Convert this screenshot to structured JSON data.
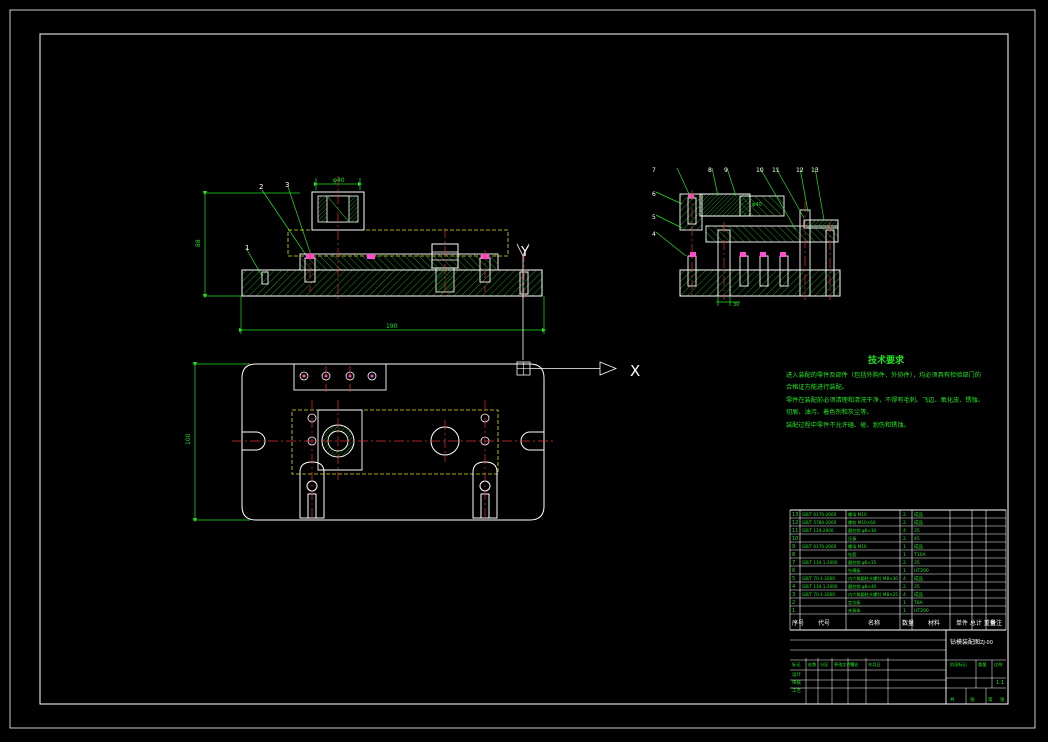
{
  "colors": {
    "background": "#000000",
    "frame": "#ffffff",
    "outline": "#ffffff",
    "hatch": "#1fa31f",
    "centerline": "#e03030",
    "dimension": "#22e322",
    "hidden": "#e0e020",
    "pink": "#ff4fd0",
    "note_text": "#22e322"
  },
  "labels": {
    "part_1": "1",
    "part_2": "2",
    "part_3": "3",
    "axis_y": "Y",
    "axis_x": "X",
    "dim_width": "190",
    "dim_height": "88",
    "dim_plan_height": "100",
    "dim_bore": "φ40",
    "sec_4": "4",
    "sec_5": "5",
    "sec_6": "6",
    "sec_7": "7",
    "sec_8": "8",
    "sec_9": "9",
    "sec_10": "10",
    "sec_11": "11",
    "sec_12": "12",
    "sec_13": "13",
    "sec_dim": "φ40",
    "sec_dim2": "30"
  },
  "technical_requirements": {
    "title": "技术要求",
    "lines": [
      "进入装配的零件及部件（包括外购件、外协件），均必须具有检验部门的",
      "合格证方能进行装配。",
      "零件在装配前必须清理和清洗干净，不得有毛刺、飞边、氧化皮、锈蚀、",
      "切屑、油污、着色剂和灰尘等。",
      "装配过程中零件不允许磕、碰、划伤和锈蚀。"
    ]
  },
  "title_block": {
    "header": [
      "序号",
      "代号",
      "名称",
      "数量",
      "材料",
      "单件 总计 重量",
      "备注"
    ],
    "rows": [
      [
        "13",
        "GB/T 6170-2000",
        "螺母 M10",
        "2",
        "成品"
      ],
      [
        "12",
        "GB/T 5780-2000",
        "螺栓 M10×60",
        "2",
        "成品"
      ],
      [
        "11",
        "GB/T 119-2000",
        "圆柱销 φ8×30",
        "4",
        "35"
      ],
      [
        "10",
        "",
        "压板",
        "2",
        "45"
      ],
      [
        "9",
        "GB/T 6170-2000",
        "螺母 M16",
        "1",
        "成品"
      ],
      [
        "8",
        "",
        "钻套",
        "1",
        "T10A"
      ],
      [
        "7",
        "GB/T 119.1-2000",
        "圆柱销 φ6×35",
        "2",
        "35"
      ],
      [
        "6",
        "",
        "钻模板",
        "1",
        "HT200"
      ],
      [
        "5",
        "GB/T 70.1-2000",
        "内六角圆柱头螺钉 M8×30",
        "4",
        "成品"
      ],
      [
        "4",
        "GB/T 119.1-2000",
        "圆柱销 φ8×40",
        "2",
        "35"
      ],
      [
        "3",
        "GB/T 70.1-2000",
        "内六角圆柱头螺钉 M8×25",
        "4",
        "成品"
      ],
      [
        "2",
        "",
        "定位板",
        "1",
        "T8A"
      ],
      [
        "1",
        "",
        "夹具体",
        "1",
        "HT200"
      ]
    ],
    "sign_labels": [
      "标记",
      "处数",
      "分区",
      "更改文件号",
      "签名",
      "年月日"
    ],
    "sign_rows": [
      "设计",
      "审核",
      "工艺"
    ],
    "stage_labels": [
      "阶段标记",
      "重量",
      "比例"
    ],
    "scale": "1:1",
    "sheet": [
      "共",
      "张",
      "第",
      "张"
    ],
    "drawing_code": "钻模装配图",
    "drawing_no": "ZJ-00"
  }
}
